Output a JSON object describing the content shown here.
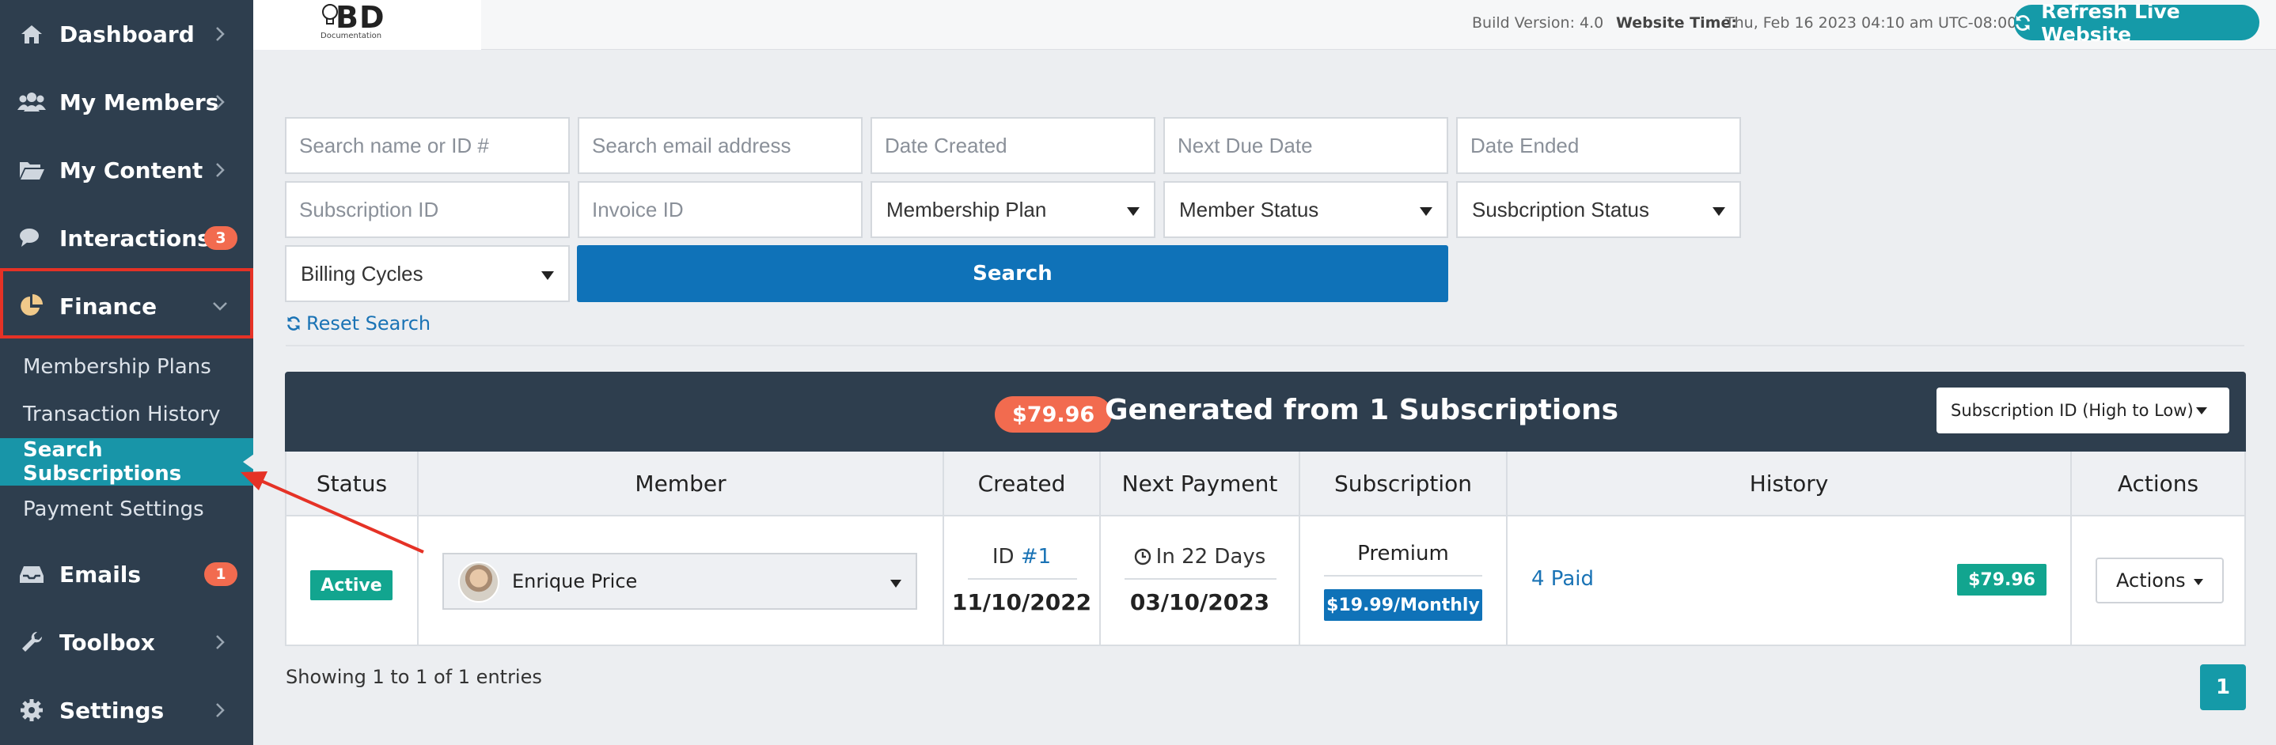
{
  "sidebar": {
    "items": [
      {
        "label": "Dashboard",
        "icon": "home-icon"
      },
      {
        "label": "My Members",
        "icon": "users-icon"
      },
      {
        "label": "My Content",
        "icon": "folder-open-icon"
      },
      {
        "label": "Interactions",
        "icon": "comments-icon",
        "badge": "3"
      },
      {
        "label": "Finance",
        "icon": "pie-chart-icon"
      },
      {
        "label": "Emails",
        "icon": "inbox-icon",
        "badge": "1"
      },
      {
        "label": "Toolbox",
        "icon": "wrench-icon"
      },
      {
        "label": "Settings",
        "icon": "gear-icon"
      }
    ],
    "finance_sub": [
      "Membership Plans",
      "Transaction History",
      "Search Subscriptions",
      "Payment Settings"
    ]
  },
  "topbar": {
    "logo_text": "BD",
    "logo_sub": "Documentation",
    "build_version": "Build Version: 4.0",
    "website_time_label": "Website Time:",
    "website_time_value": "Thu, Feb 16 2023 04:10 am UTC-08:00",
    "refresh_label": "Refresh Live Website"
  },
  "filters": {
    "name_placeholder": "Search name or ID #",
    "email_placeholder": "Search email address",
    "date_created_placeholder": "Date Created",
    "next_due_placeholder": "Next Due Date",
    "date_ended_placeholder": "Date Ended",
    "subscription_id_placeholder": "Subscription ID",
    "invoice_id_placeholder": "Invoice ID",
    "membership_plan": "Membership Plan",
    "member_status": "Member Status",
    "subscription_status": "Susbcription Status",
    "billing_cycles": "Billing Cycles",
    "search_label": "Search",
    "reset_label": "Reset Search"
  },
  "summary": {
    "amount": "$79.96",
    "text": "Generated from 1 Subscriptions",
    "sort_label": "Subscription ID (High to Low)"
  },
  "table": {
    "headers": [
      "Status",
      "Member",
      "Created",
      "Next Payment",
      "Subscription",
      "History",
      "Actions"
    ],
    "rows": [
      {
        "status": "Active",
        "member": "Enrique Price",
        "id_prefix": "ID ",
        "id_link": "#1",
        "created": "11/10/2022",
        "next_in": "In 22 Days",
        "next_date": "03/10/2023",
        "plan": "Premium",
        "price": "$19.99/Monthly",
        "history_link": "4 Paid",
        "history_amount": "$79.96",
        "actions": "Actions"
      }
    ]
  },
  "footer": {
    "showing": "Showing 1 to 1 of 1 entries",
    "page": "1"
  },
  "colors": {
    "sidebar": "#2e3e4e",
    "accent_teal": "#159aa8",
    "primary_blue": "#0f72b8",
    "badge_orange": "#f26b4f",
    "success_green": "#12a58f",
    "highlight_red": "#e53226"
  }
}
